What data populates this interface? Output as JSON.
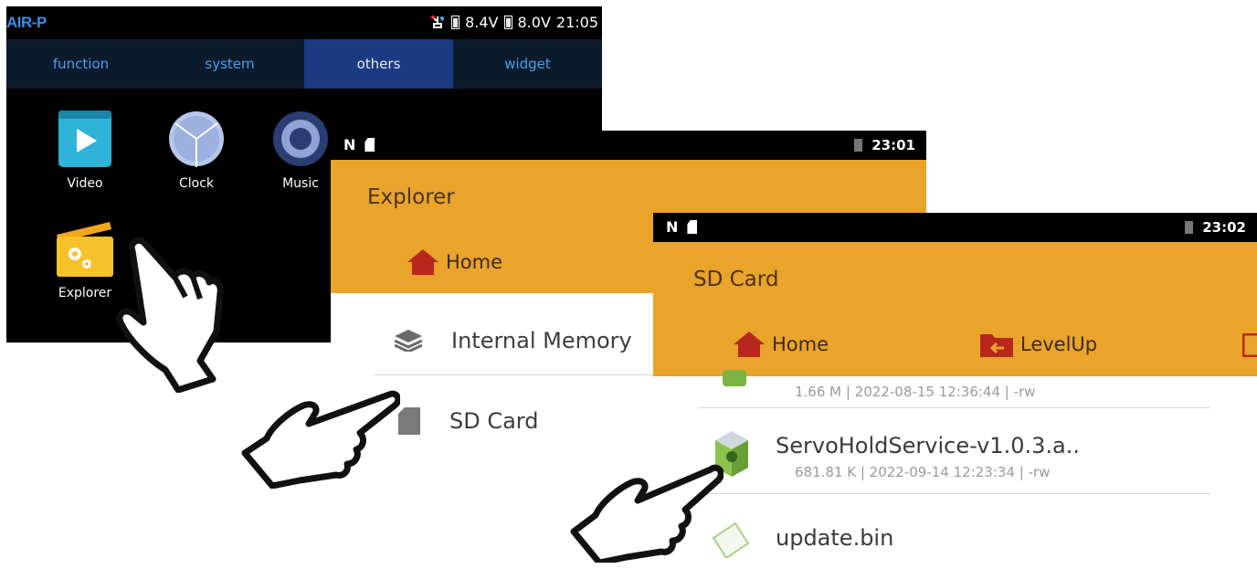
{
  "launcher": {
    "brand": "AIR-P",
    "battery1": "8.4V",
    "battery2": "8.0V",
    "clock": "21:05",
    "tabs": [
      {
        "label": "function"
      },
      {
        "label": "system"
      },
      {
        "label": "others"
      },
      {
        "label": "widget"
      }
    ],
    "active_tab": "others",
    "apps": [
      {
        "label": "Video",
        "icon": "video-icon"
      },
      {
        "label": "Clock",
        "icon": "clock-icon"
      },
      {
        "label": "Music",
        "icon": "music-icon"
      },
      {
        "label": "Explorer",
        "icon": "explorer-icon"
      }
    ]
  },
  "explorer": {
    "clock": "23:01",
    "title": "Explorer",
    "home_label": "Home",
    "items": [
      {
        "label": "Internal Memory",
        "icon": "layers-icon"
      },
      {
        "label": "SD Card",
        "icon": "sd-card-icon"
      }
    ]
  },
  "sdcard": {
    "clock": "23:02",
    "title": "SD Card",
    "home_label": "Home",
    "levelup_label": "LevelUp",
    "files": [
      {
        "name": "",
        "meta": "1.66 M | 2022-08-15 12:36:44 | -rw",
        "icon": "apk-icon"
      },
      {
        "name": "ServoHoldService-v1.0.3.a..",
        "meta": "681.81 K | 2022-09-14 12:23:34 | -rw",
        "icon": "apk-icon"
      },
      {
        "name": "update.bin",
        "meta": "",
        "icon": "file-icon"
      }
    ]
  },
  "colors": {
    "accent": "#eaa32b",
    "tab_bar": "#0c1b2c",
    "tab_active": "#1b3a82",
    "tab_text": "#4a9fee"
  }
}
